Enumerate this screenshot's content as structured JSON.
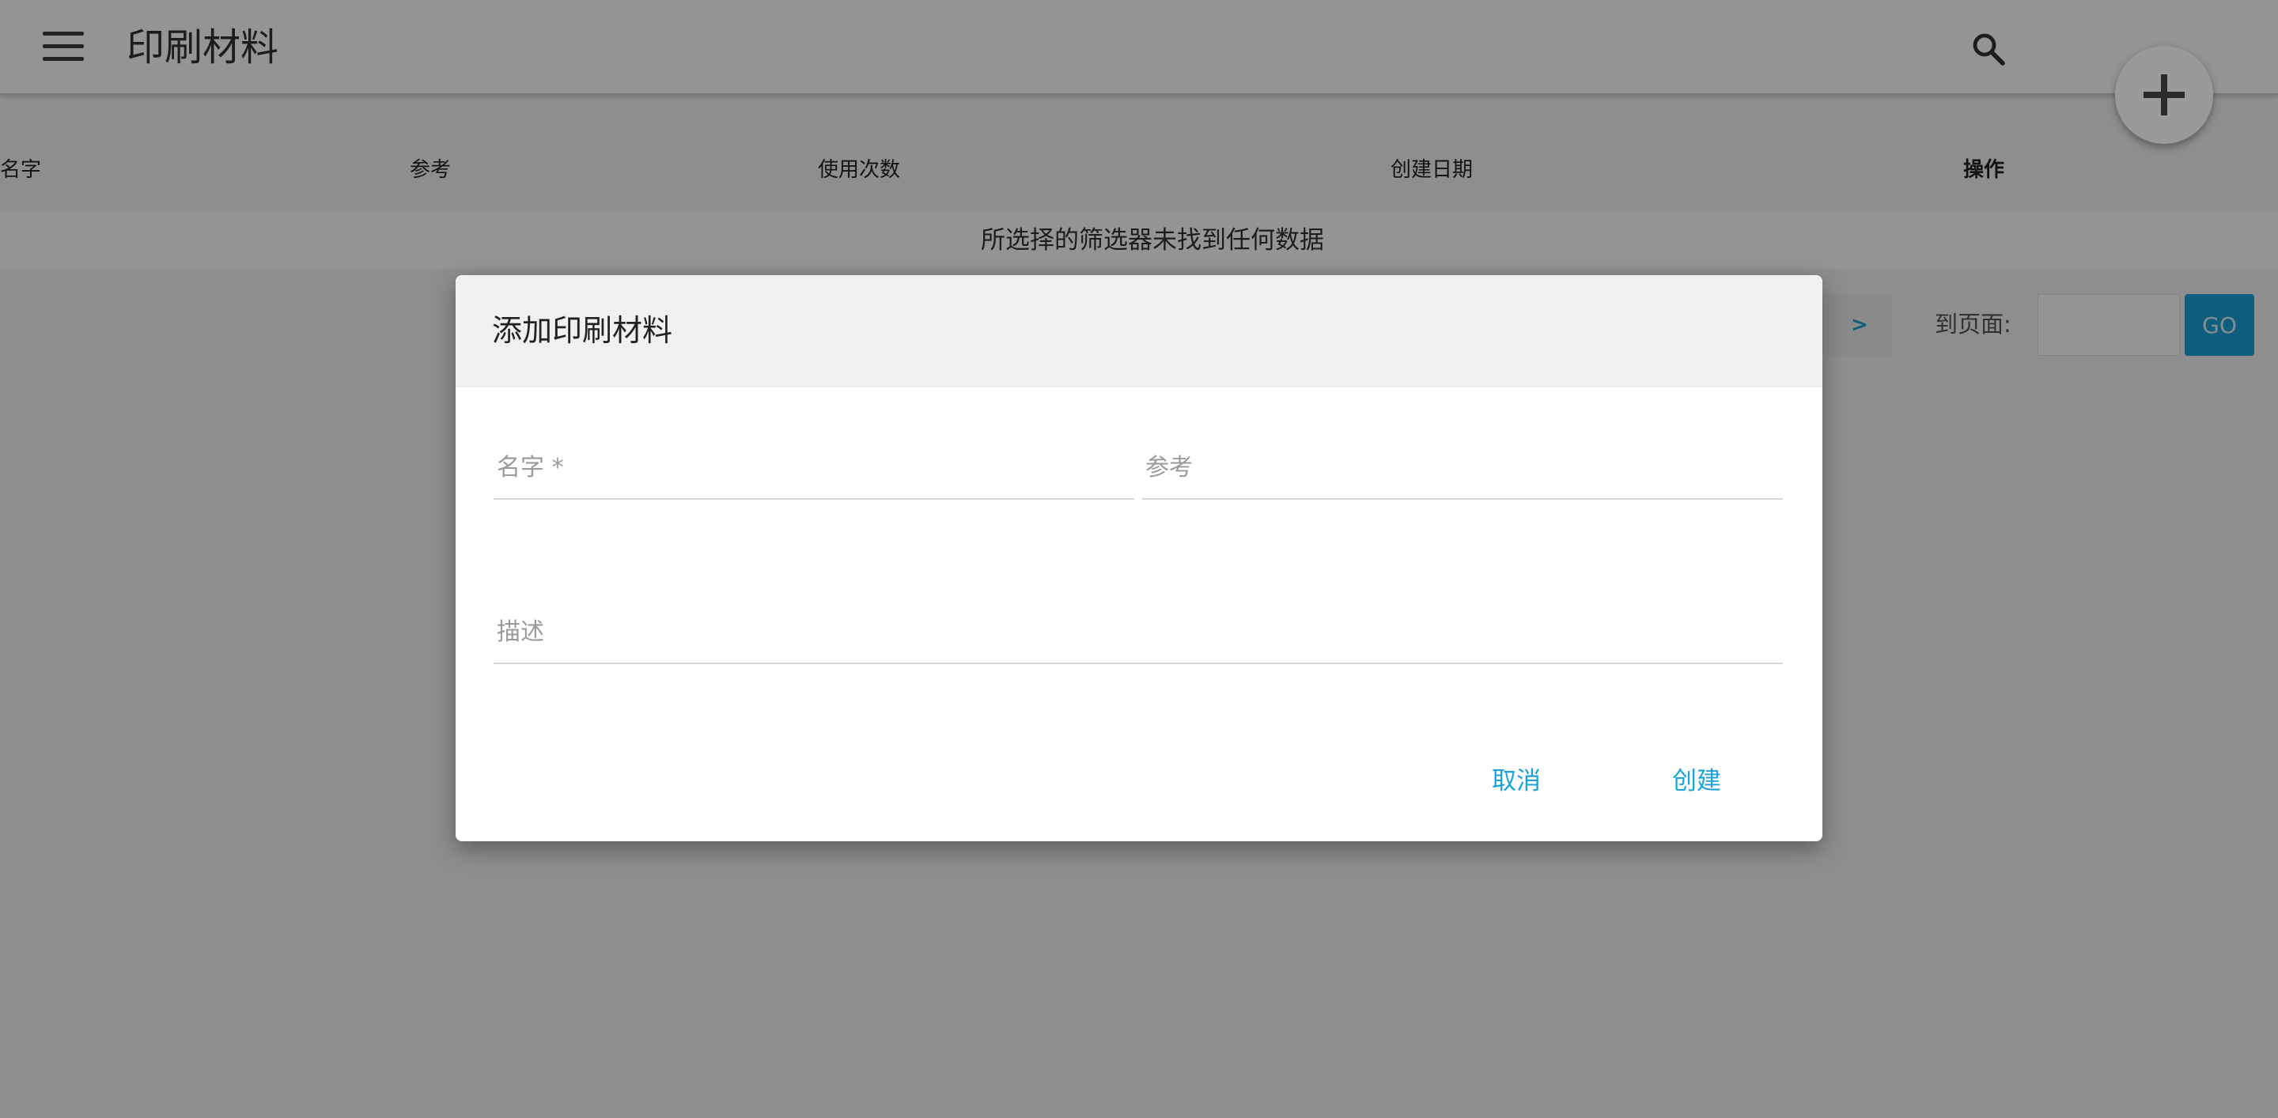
{
  "header": {
    "title": "印刷材料"
  },
  "table": {
    "columns": [
      "名字",
      "参考",
      "使用次数",
      "创建日期",
      "操作"
    ],
    "empty_message": "所选择的筛选器未找到任何数据"
  },
  "pagination": {
    "next_label": ">",
    "goto_label": "到页面:",
    "goto_value": "",
    "go_label": "GO"
  },
  "dialog": {
    "title": "添加印刷材料",
    "fields": {
      "name": {
        "label": "名字 *",
        "value": ""
      },
      "reference": {
        "label": "参考",
        "value": ""
      },
      "description": {
        "label": "描述",
        "value": ""
      }
    },
    "cancel_label": "取消",
    "create_label": "创建"
  },
  "colors": {
    "accent": "#1aa3d9",
    "overlay": "rgba(0,0,0,0.42)",
    "dialog_header": "#f0f0f0"
  },
  "icons": {
    "menu": "menu-icon",
    "search": "search-icon",
    "add": "plus-icon"
  }
}
